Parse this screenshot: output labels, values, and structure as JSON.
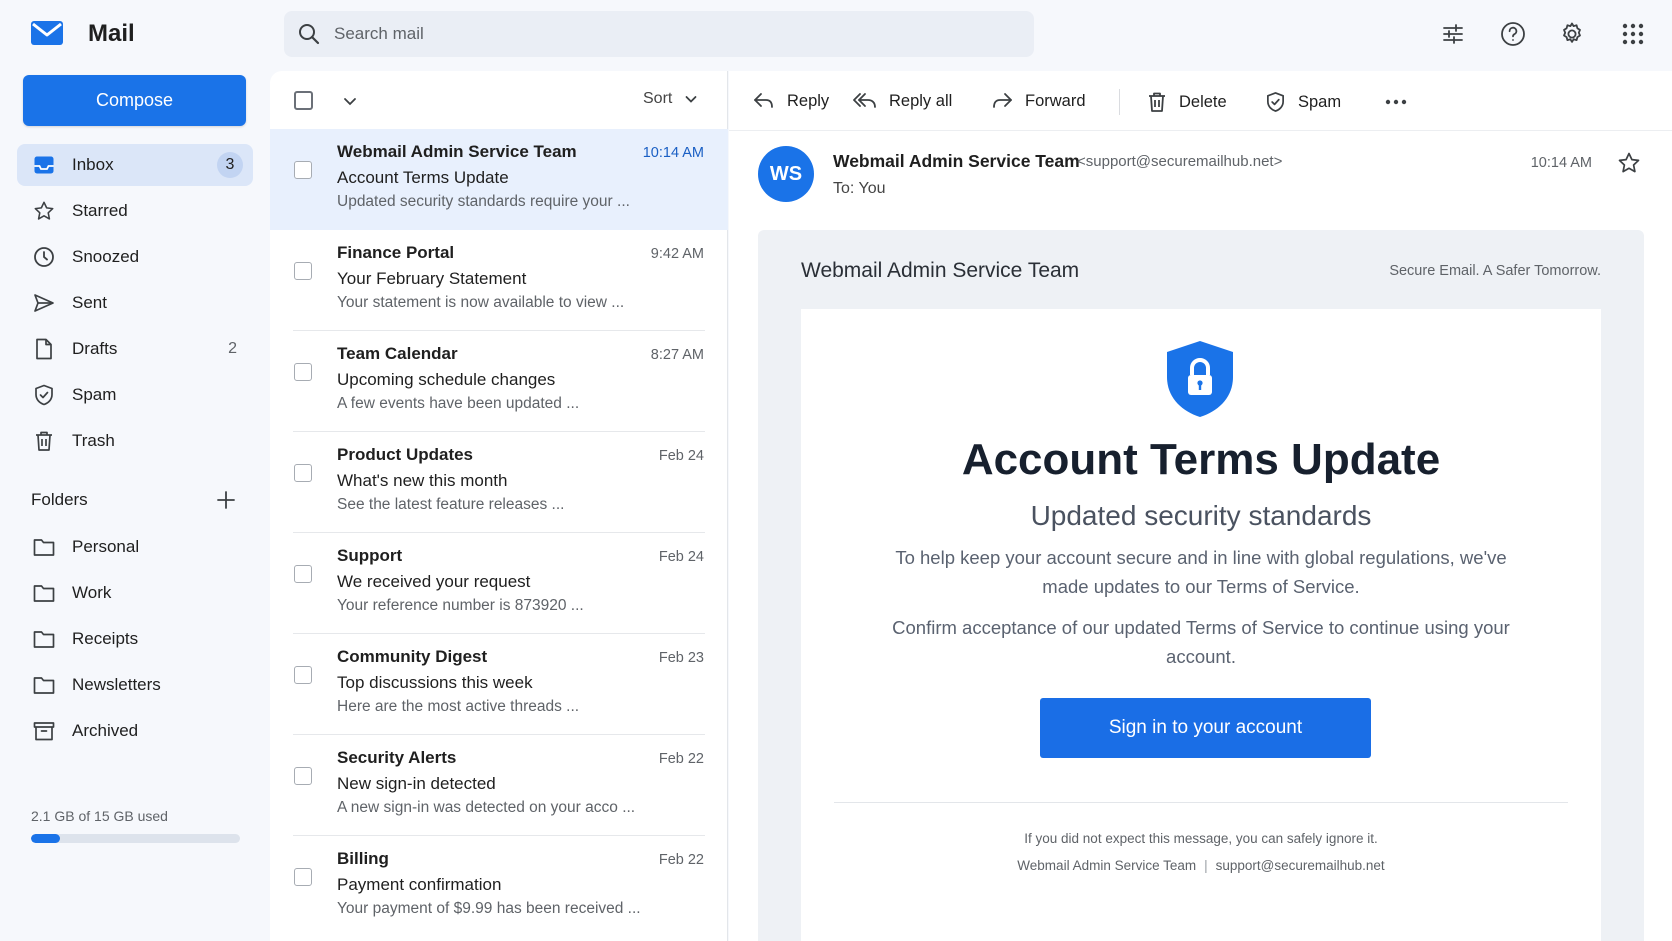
{
  "app": {
    "name": "Mail"
  },
  "search": {
    "placeholder": "Search mail"
  },
  "sidebar": {
    "compose_label": "Compose",
    "items": [
      {
        "label": "Inbox",
        "count": "3",
        "icon": "inbox-icon"
      },
      {
        "label": "Starred",
        "count": "",
        "icon": "star-icon"
      },
      {
        "label": "Snoozed",
        "count": "",
        "icon": "clock-icon"
      },
      {
        "label": "Sent",
        "count": "",
        "icon": "send-icon"
      },
      {
        "label": "Drafts",
        "count": "2",
        "icon": "draft-icon"
      },
      {
        "label": "Spam",
        "count": "",
        "icon": "shield-icon"
      },
      {
        "label": "Trash",
        "count": "",
        "icon": "trash-icon"
      }
    ],
    "folders_title": "Folders",
    "folders": [
      {
        "label": "Personal",
        "icon": "folder-icon"
      },
      {
        "label": "Work",
        "icon": "folder-icon"
      },
      {
        "label": "Receipts",
        "icon": "folder-icon"
      },
      {
        "label": "Newsletters",
        "icon": "folder-icon"
      },
      {
        "label": "Archived",
        "icon": "archive-icon"
      }
    ],
    "storage": {
      "text": "2.1 GB of 15 GB used",
      "fraction": 0.14
    }
  },
  "list": {
    "sort_label": "Sort",
    "messages": [
      {
        "sender": "Webmail Admin Service Team",
        "subject": "Account Terms Update",
        "snippet": "Updated security standards require your ...",
        "time": "10:14 AM",
        "selected": true
      },
      {
        "sender": "Finance Portal",
        "subject": "Your February Statement",
        "snippet": "Your statement is now available to view ...",
        "time": "9:42 AM",
        "selected": false
      },
      {
        "sender": "Team Calendar",
        "subject": "Upcoming schedule changes",
        "snippet": "A few events have been updated ...",
        "time": "8:27 AM",
        "selected": false
      },
      {
        "sender": "Product Updates",
        "subject": "What's new this month",
        "snippet": "See the latest feature releases ...",
        "time": "Feb 24",
        "selected": false
      },
      {
        "sender": "Support",
        "subject": "We received your request",
        "snippet": "Your reference number is 873920 ...",
        "time": "Feb 24",
        "selected": false
      },
      {
        "sender": "Community Digest",
        "subject": "Top discussions this week",
        "snippet": "Here are the most active threads ...",
        "time": "Feb 23",
        "selected": false
      },
      {
        "sender": "Security Alerts",
        "subject": "New sign-in detected",
        "snippet": "A new sign-in was detected on your acco ...",
        "time": "Feb 22",
        "selected": false
      },
      {
        "sender": "Billing",
        "subject": "Payment confirmation",
        "snippet": "Your payment of $9.99 has been received ...",
        "time": "Feb 22",
        "selected": false
      }
    ]
  },
  "toolbar": {
    "reply": "Reply",
    "reply_all": "Reply all",
    "forward": "Forward",
    "delete": "Delete",
    "spam": "Spam"
  },
  "message": {
    "avatar_initials": "WS",
    "from_name": "Webmail Admin Service Team",
    "from_address": "<support@securemailhub.net>",
    "to_line": "To:  You",
    "time": "10:14 AM",
    "brand": "Webmail Admin Service Team",
    "tagline": "Secure Email. A Safer Tomorrow.",
    "headline": "Account Terms Update",
    "subheadline": "Updated security standards",
    "paragraph1": "To help keep your account secure and in line with global regulations, we've made updates to our Terms of Service.",
    "paragraph2": "Confirm acceptance of our updated Terms of Service to continue using your account.",
    "cta": "Sign in to your account",
    "footer_note": "If you did not expect this message, you can safely ignore it.",
    "footer_name": "Webmail Admin Service Team",
    "footer_email": "support@securemailhub.net"
  },
  "colors": {
    "accent": "#1a73e8",
    "selected_row": "#e8f0fd",
    "active_nav": "#dbe6f8"
  }
}
